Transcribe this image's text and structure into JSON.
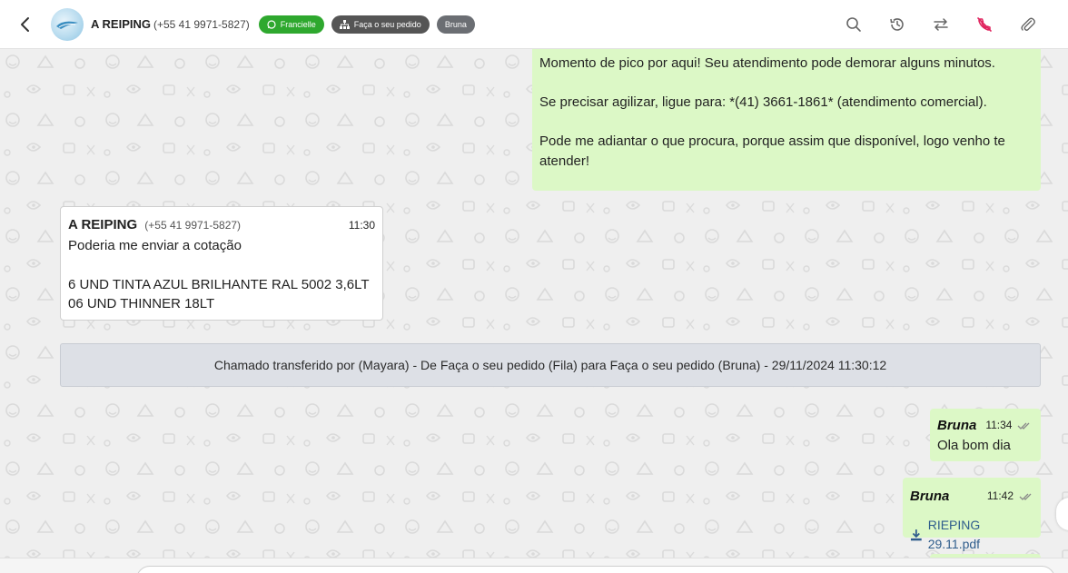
{
  "header": {
    "contact_name": "A REIPING",
    "contact_phone": "(+55 41 9971-5827)",
    "tags": [
      {
        "label": "Francielle",
        "color": "#2ea82e",
        "icon": "whatsapp-icon"
      },
      {
        "label": "Faça o seu pedido",
        "color": "#555555",
        "icon": "sitemap-icon"
      },
      {
        "label": "Bruna",
        "color": "#6b6e73"
      }
    ],
    "tools": [
      "search-icon",
      "history-icon",
      "transfer-arrows-icon",
      "end-call-icon",
      "paperclip-icon"
    ]
  },
  "messages": {
    "auto_reply": {
      "text": "Momento de pico por aqui! Seu atendimento pode demorar alguns minutos.\n\nSe precisar agilizar, ligue para: *(41) 3661-1861* (atendimento comercial).\n\nPode me adiantar o que procura, porque assim que disponível, logo venho te atender!"
    },
    "customer": {
      "sender": "A REIPING",
      "phone": "(+55 41 9971-5827)",
      "time": "11:30",
      "text": "Poderia me enviar a cotação\n\n6 UND TINTA AZUL BRILHANTE RAL 5002 3,6LT\n06 UND THINNER 18LT"
    },
    "system": {
      "text": "Chamado transferido por (Mayara) - De Faça o seu pedido (Fila) para Faça o seu pedido (Bruna) - 29/11/2024 11:30:12"
    },
    "greeting": {
      "author": "Bruna",
      "time": "11:34",
      "text": "Ola bom dia"
    },
    "file": {
      "author": "Bruna",
      "time": "11:42",
      "filename": "RIEPING 29.11.pdf"
    }
  },
  "colors": {
    "outgoing_bubble": "#dcf8c6",
    "incoming_bubble": "#ffffff",
    "system_note": "#dde0e6",
    "end_call_icon": "#e0245e"
  }
}
